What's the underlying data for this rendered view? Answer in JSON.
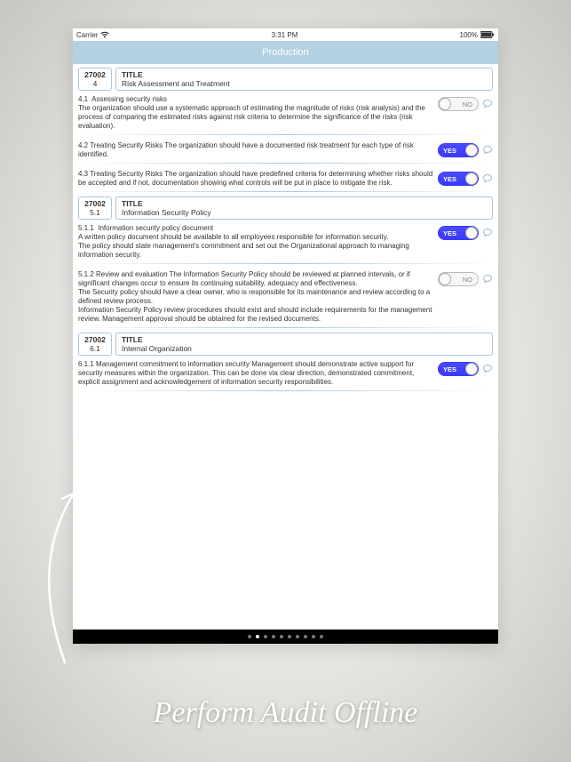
{
  "statusbar": {
    "carrier": "Carrier",
    "time": "3:31 PM",
    "battery": "100%"
  },
  "navbar": {
    "title": "Production"
  },
  "sections": [
    {
      "code_std": "27002",
      "code_sec": "4",
      "title_label": "TITLE",
      "title_text": "Risk Assessment and Treatment",
      "items": [
        {
          "num": "4.1",
          "name": "Assessing security risks",
          "desc": "The organization should use a systematic approach of estimating the magnitude of risks (risk analysis) and the process of comparing the estimated risks against risk criteria to determine the significance of the risks (risk evaluation).",
          "toggle": "NO"
        },
        {
          "num": "4.2",
          "name": "Treating Security Risks",
          "desc": "The organization should have a documented risk treatment for each type of risk identified.",
          "toggle": "YES"
        },
        {
          "num": "4.3",
          "name": "Treating Security Risks",
          "desc": "The organization should have predefined criteria for determining whether risks should be accepted and if not, documentation showing what controls will be put in place to mitigate the risk.",
          "toggle": "YES"
        }
      ]
    },
    {
      "code_std": "27002",
      "code_sec": "5.1",
      "title_label": "TITLE",
      "title_text": "Information Security Policy",
      "items": [
        {
          "num": "5.1.1",
          "name": "Information security policy document",
          "desc": "A written policy document should be available to all employees responsible for information security.\nThe policy should state management's commitment and set out the Organizational approach to managing information security.",
          "toggle": "YES"
        },
        {
          "num": "5.1.2",
          "name": "Review and evaluation",
          "desc": "The Information Security Policy should be reviewed at planned intervals, or if significant changes occur to ensure its continuing suitability, adequacy and effectiveness.\nThe Security policy should have a clear owner, who is responsible for its maintenance and review according to a defined review process.\nInformation Security Policy review procedures should exist and should include requirements for the management review. Management approval should be obtained for the revised documents.",
          "toggle": "NO"
        }
      ]
    },
    {
      "code_std": "27002",
      "code_sec": "6.1",
      "title_label": "TITLE",
      "title_text": "Internal Organization",
      "items": [
        {
          "num": "6.1.1",
          "name": "Management commitment to information security",
          "desc": "Management should demonstrate active support for security measures within the organization. This can be done via clear direction, demonstrated commitment, explicit assignment and acknowledgement of information security responsibilities.",
          "toggle": "YES"
        }
      ]
    }
  ],
  "pager": {
    "count": 10,
    "active": 1
  },
  "caption": "Perform Audit Offline"
}
